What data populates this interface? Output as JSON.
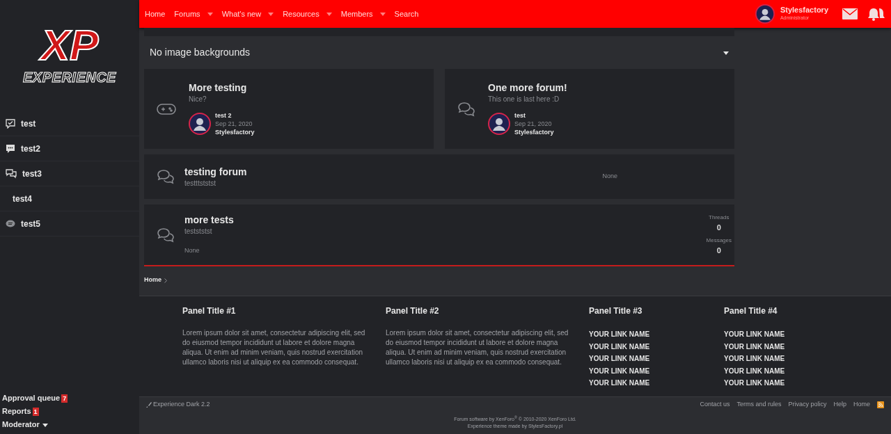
{
  "logo": {
    "title": "XP",
    "subtitle": "EXPERIENCE"
  },
  "sidebar": {
    "items": [
      {
        "label": "test"
      },
      {
        "label": "test2"
      },
      {
        "label": "test3"
      },
      {
        "label": "test4"
      },
      {
        "label": "test5"
      }
    ],
    "moderator": [
      {
        "label": "Approval queue",
        "badge": "7"
      },
      {
        "label": "Reports",
        "badge": "1"
      },
      {
        "label": "Moderator",
        "caret": true
      }
    ]
  },
  "nav": {
    "items": [
      {
        "label": "Home",
        "dropdown": false
      },
      {
        "label": "Forums",
        "dropdown": true
      },
      {
        "label": "What's new",
        "dropdown": true
      },
      {
        "label": "Resources",
        "dropdown": true
      },
      {
        "label": "Members",
        "dropdown": true
      },
      {
        "label": "Search",
        "dropdown": false
      }
    ],
    "user": {
      "name": "Stylesfactory",
      "role": "Administrator"
    }
  },
  "category": {
    "title": "No image backgrounds",
    "expanded": true
  },
  "cards": [
    {
      "title": "More testing",
      "description": "Nice?",
      "last_thread": "test 2",
      "date": "Sep 21, 2020",
      "user": "Stylesfactory"
    },
    {
      "title": "One more forum!",
      "description": "This one is last here :D",
      "last_thread": "test",
      "date": "Sep 21, 2020",
      "user": "Stylesfactory"
    }
  ],
  "rows": [
    {
      "title": "testing forum",
      "description": "testttststst",
      "last_post": "None"
    },
    {
      "title": "more tests",
      "description": "testststst",
      "last_post": "None",
      "stats": [
        {
          "label": "Threads",
          "value": "0"
        },
        {
          "label": "Messages",
          "value": "0"
        }
      ]
    }
  ],
  "breadcrumb": [
    "Home"
  ],
  "panels": [
    {
      "title": "Panel Title #1",
      "text": "Lorem ipsum dolor sit amet, consectetur adipiscing elit, sed do eiusmod tempor incididunt ut labore et dolore magna aliqua. Ut enim ad minim veniam, quis nostrud exercitation ullamco laboris nisi ut aliquip ex ea commodo consequat."
    },
    {
      "title": "Panel Title #2",
      "text": "Lorem ipsum dolor sit amet, consectetur adipiscing elit, sed do eiusmod tempor incididunt ut labore et dolore magna aliqua. Ut enim ad minim veniam, quis nostrud exercitation ullamco laboris nisi ut aliquip ex ea commodo consequat."
    },
    {
      "title": "Panel Title #3",
      "links": [
        "YOUR LINK NAME",
        "YOUR LINK NAME",
        "YOUR LINK NAME",
        "YOUR LINK NAME",
        "YOUR LINK NAME"
      ]
    },
    {
      "title": "Panel Title #4",
      "links": [
        "YOUR LINK NAME",
        "YOUR LINK NAME",
        "YOUR LINK NAME",
        "YOUR LINK NAME",
        "YOUR LINK NAME"
      ]
    }
  ],
  "footer": {
    "style": "Experience Dark 2.2",
    "links": [
      "Contact us",
      "Terms and rules",
      "Privacy policy",
      "Help",
      "Home"
    ],
    "copyright": "Forum software by XenForo$^{®}$ © 2010-2020 XenForo Ltd.",
    "credit": "Experience theme made by StylesFactory.pl"
  }
}
